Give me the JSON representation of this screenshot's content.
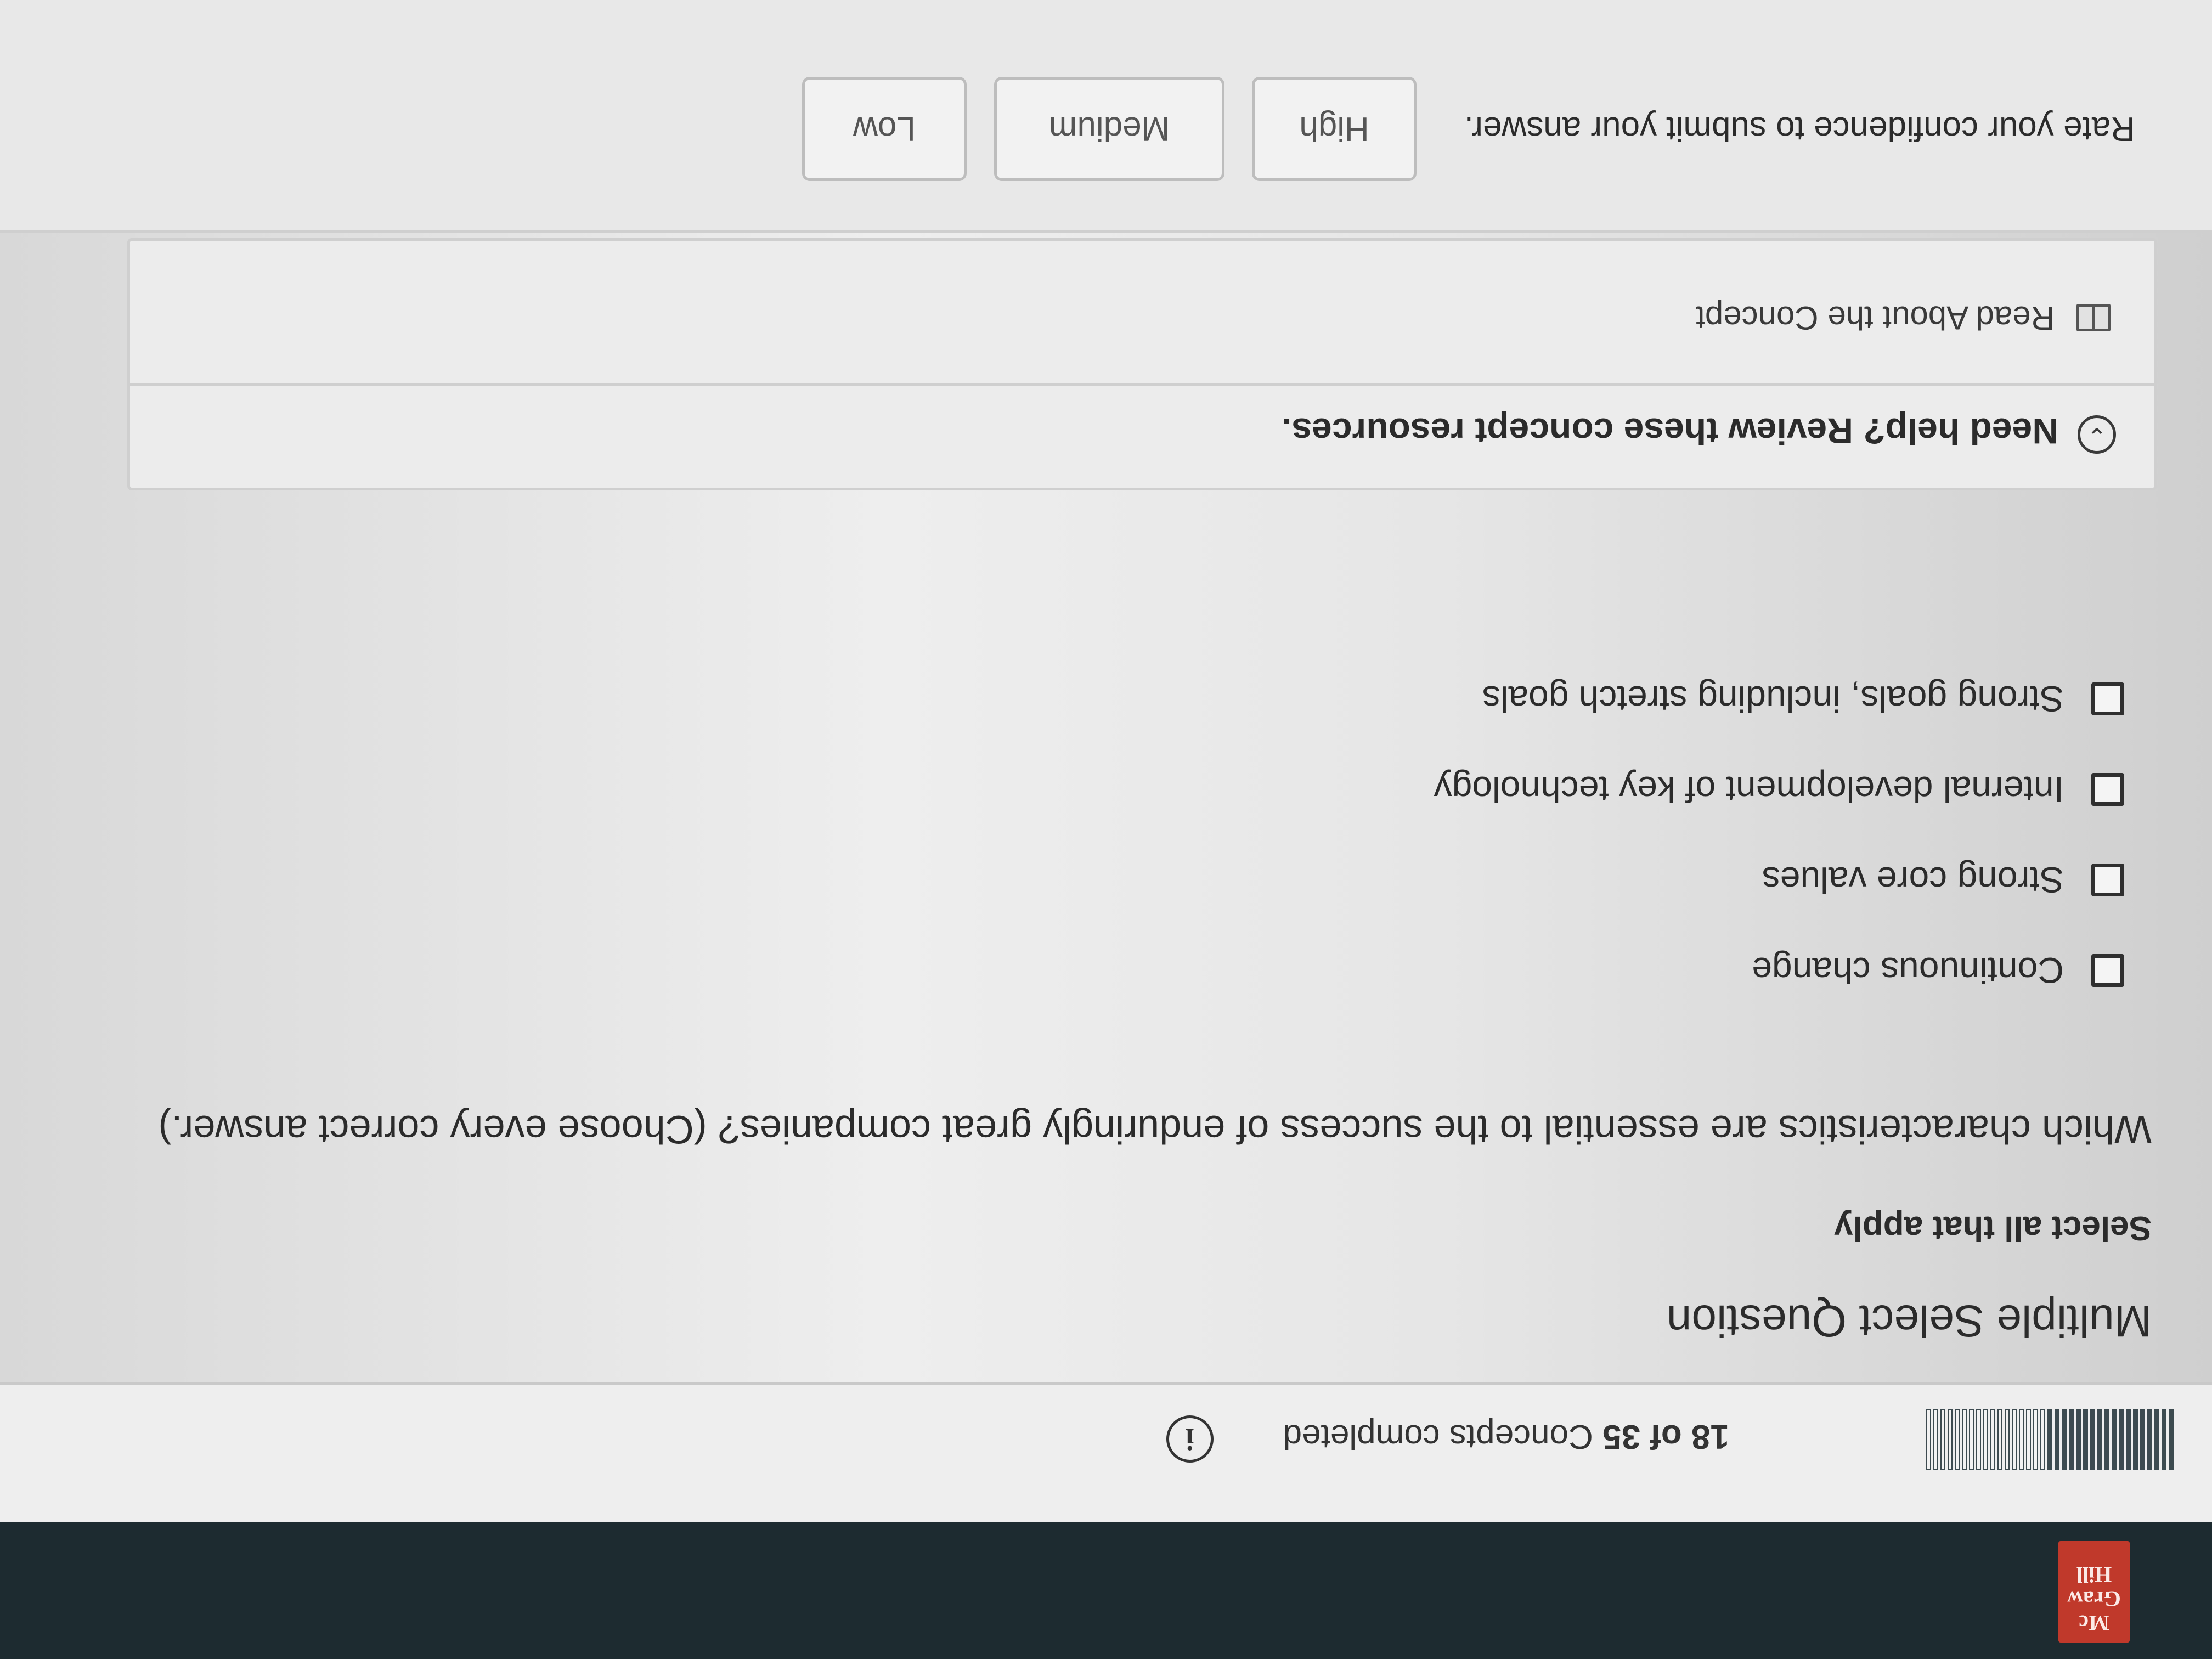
{
  "header": {
    "logo_lines": [
      "Mc",
      "Graw",
      "Hill"
    ]
  },
  "progress": {
    "completed": 18,
    "total": 35,
    "count_text": "18 of 35",
    "label": "Concepts completed"
  },
  "question": {
    "type": "Multiple Select Question",
    "instruction": "Select all that apply",
    "prompt": "Which characteristics are essential to the success of enduringly great companies? (Choose every correct answer.)",
    "options": [
      {
        "label": "Continuous change",
        "checked": false
      },
      {
        "label": "Strong core values",
        "checked": false
      },
      {
        "label": "Internal development of key technology",
        "checked": false
      },
      {
        "label": "Strong goals, including stretch goals",
        "checked": false
      }
    ]
  },
  "help": {
    "title": "Need help? Review these concept resources.",
    "link_label": "Read About the Concept"
  },
  "confidence": {
    "label": "Rate your confidence to submit your answer.",
    "buttons": [
      "High",
      "Medium",
      "Low"
    ]
  },
  "colors": {
    "header_bg": "#1d2b30",
    "logo_bg": "#c0392b",
    "progress_fill": "#3d4b50"
  }
}
